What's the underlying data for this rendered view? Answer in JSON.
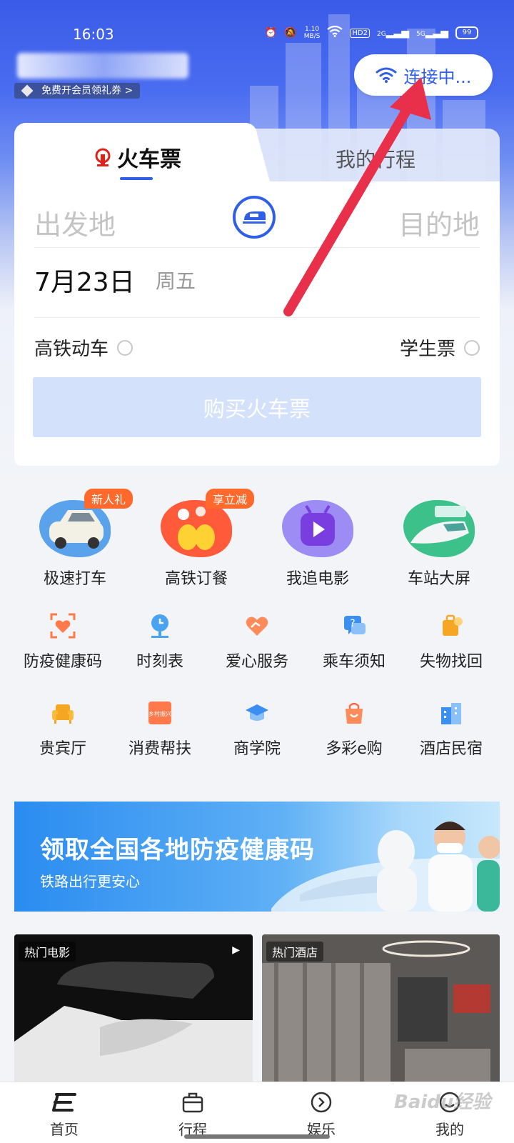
{
  "status_bar": {
    "time": "16:03",
    "net_speed_top": "1.10",
    "net_speed_bottom": "MB/S",
    "hd": "HD2",
    "sig1": "2G",
    "sig2": "5G",
    "battery": "99"
  },
  "header": {
    "member_tag": "免费开会员领礼券 >",
    "wifi_label": "连接中..."
  },
  "ticket": {
    "tab_active": "火车票",
    "tab_inactive": "我的行程",
    "from_placeholder": "出发地",
    "to_placeholder": "目的地",
    "date": "7月23日",
    "weekday": "周五",
    "option_left": "高铁动车",
    "option_right": "学生票",
    "buy_button": "购买火车票"
  },
  "big_services": [
    {
      "label": "极速打车",
      "badge": "新人礼",
      "color": "#5aa3ec"
    },
    {
      "label": "高铁订餐",
      "badge": "享立减",
      "color": "#ff5a3a"
    },
    {
      "label": "我追电影",
      "badge": "",
      "color": "#8a7cf0"
    },
    {
      "label": "车站大屏",
      "badge": "",
      "color": "#3cc18a"
    }
  ],
  "grid_row1": [
    {
      "label": "防疫健康码",
      "icon": "health-code-icon",
      "color": "#ff7a4a"
    },
    {
      "label": "时刻表",
      "icon": "timetable-icon",
      "color": "#4aa3f0"
    },
    {
      "label": "爱心服务",
      "icon": "heart-hand-icon",
      "color": "#ff6b4a"
    },
    {
      "label": "乘车须知",
      "icon": "question-chat-icon",
      "color": "#3a8ff0"
    },
    {
      "label": "失物找回",
      "icon": "luggage-icon",
      "color": "#f5a623"
    }
  ],
  "grid_row2": [
    {
      "label": "贵宾厅",
      "icon": "sofa-icon",
      "color": "#f5a623"
    },
    {
      "label": "消费帮扶",
      "icon": "village-icon",
      "color": "#ff6b4a",
      "icon_text": "乡村振兴"
    },
    {
      "label": "商学院",
      "icon": "graduation-cap-icon",
      "color": "#3a8ff0"
    },
    {
      "label": "多彩e购",
      "icon": "shopping-bag-icon",
      "color": "#ff6b4a"
    },
    {
      "label": "酒店民宿",
      "icon": "building-icon",
      "color": "#3a8ff0"
    }
  ],
  "banner": {
    "title": "领取全国各地防疫健康码",
    "subtitle": "铁路出行更安心"
  },
  "cards": {
    "left_tag": "热门电影",
    "right_tag": "热门酒店"
  },
  "tabbar": [
    {
      "label": "首页",
      "active": true
    },
    {
      "label": "行程",
      "active": false
    },
    {
      "label": "娱乐",
      "active": false
    },
    {
      "label": "我的",
      "active": false
    }
  ],
  "watermark": "Baidu经验",
  "colors": {
    "accent": "#2f5fe8",
    "arrow": "#e8304a",
    "buy_disabled": "#d4e1fb"
  }
}
